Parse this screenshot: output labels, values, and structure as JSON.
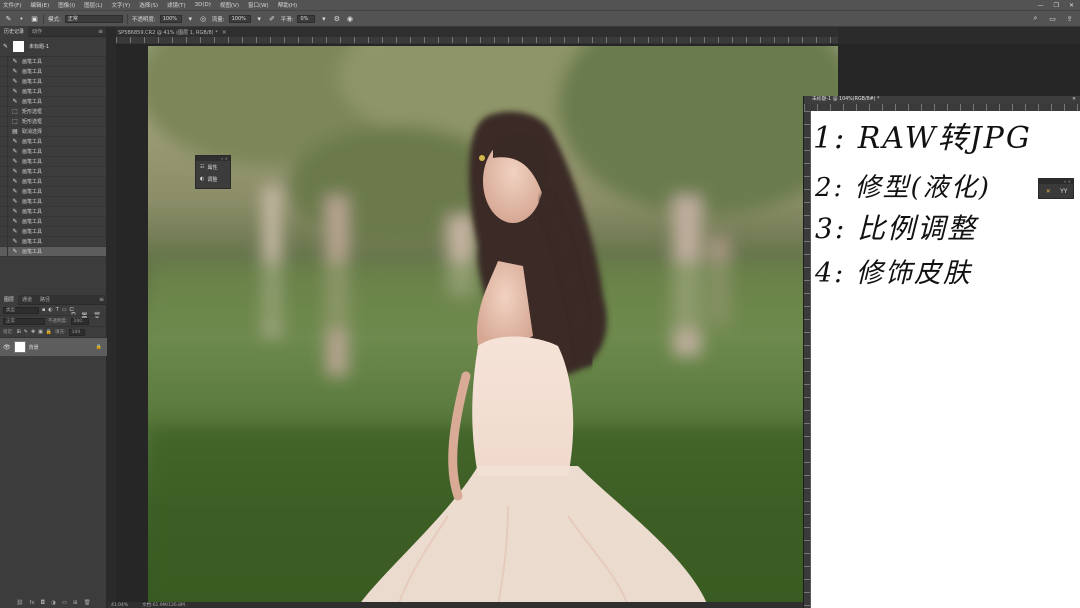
{
  "menubar": {
    "items": [
      "文件(F)",
      "编辑(E)",
      "图像(I)",
      "图层(L)",
      "文字(Y)",
      "选择(S)",
      "滤镜(T)",
      "3D(D)",
      "视图(V)",
      "窗口(W)",
      "帮助(H)"
    ],
    "window_controls": [
      "—",
      "❐",
      "✕"
    ]
  },
  "options_bar": {
    "mode_label": "模式:",
    "mode_value": "正常",
    "opacity_label": "不透明度:",
    "opacity_value": "100%",
    "flow_label": "流量:",
    "flow_value": "100%",
    "smooth_label": "平滑:",
    "smooth_value": "0%",
    "right_icons": [
      "search-icon",
      "workspace-icon",
      "share-icon"
    ]
  },
  "history_panel": {
    "tabs": [
      "历史记录",
      "动作"
    ],
    "snapshot_label": "未标题-1",
    "items": [
      {
        "icon": "brush",
        "label": "画笔工具"
      },
      {
        "icon": "brush",
        "label": "画笔工具"
      },
      {
        "icon": "brush",
        "label": "画笔工具"
      },
      {
        "icon": "brush",
        "label": "画笔工具"
      },
      {
        "icon": "brush",
        "label": "画笔工具"
      },
      {
        "icon": "marquee",
        "label": "矩形选框"
      },
      {
        "icon": "marquee",
        "label": "矩形选框"
      },
      {
        "icon": "doc",
        "label": "取消选择"
      },
      {
        "icon": "brush",
        "label": "画笔工具"
      },
      {
        "icon": "brush",
        "label": "画笔工具"
      },
      {
        "icon": "brush",
        "label": "画笔工具"
      },
      {
        "icon": "brush",
        "label": "画笔工具"
      },
      {
        "icon": "brush",
        "label": "画笔工具"
      },
      {
        "icon": "brush",
        "label": "画笔工具"
      },
      {
        "icon": "brush",
        "label": "画笔工具"
      },
      {
        "icon": "brush",
        "label": "画笔工具"
      },
      {
        "icon": "brush",
        "label": "画笔工具"
      },
      {
        "icon": "brush",
        "label": "画笔工具"
      },
      {
        "icon": "brush",
        "label": "画笔工具"
      },
      {
        "icon": "brush",
        "label": "画笔工具"
      }
    ]
  },
  "layers_panel": {
    "tabs": [
      "图层",
      "通道",
      "路径"
    ],
    "search_placeholder": "类型",
    "blend_mode": "正常",
    "opacity_label": "不透明度:",
    "opacity_value": "100",
    "lock_label": "锁定:",
    "fill_label": "填充:",
    "fill_value": "100",
    "layer_name": "背景"
  },
  "document": {
    "tab_title": "SP5B6859.CR2 @ 41% (图层 1, RGB/8) *",
    "props_items": [
      "属性",
      "调整"
    ]
  },
  "second_document": {
    "title": "未标题-1 @ 104%(RGB/8#) *",
    "notes": [
      "1: RAW转JPG",
      "2: 修型(液化)",
      "3: 比例调整",
      "4: 修饰皮肤"
    ]
  },
  "mini_tools": {
    "b2": "YY"
  },
  "status": {
    "zoom": "41.04%",
    "doc": "文档:61.9M/126.8M"
  }
}
